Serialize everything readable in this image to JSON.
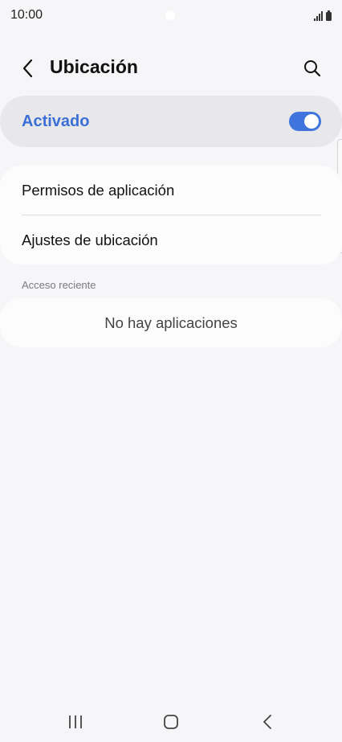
{
  "status_bar": {
    "time": "10:00"
  },
  "header": {
    "title": "Ubicación",
    "back_icon": "chevron-left-icon",
    "search_icon": "search-icon"
  },
  "master_switch": {
    "label": "Activado",
    "state": "on",
    "accent_color": "#3e74db"
  },
  "settings_items": [
    {
      "label": "Permisos de aplicación"
    },
    {
      "label": "Ajustes de ubicación"
    }
  ],
  "recent_access": {
    "header": "Acceso reciente",
    "empty_text": "No hay aplicaciones"
  },
  "nav_bar": {
    "recents_icon": "recents-icon",
    "home_icon": "home-icon",
    "back_icon": "back-icon"
  }
}
